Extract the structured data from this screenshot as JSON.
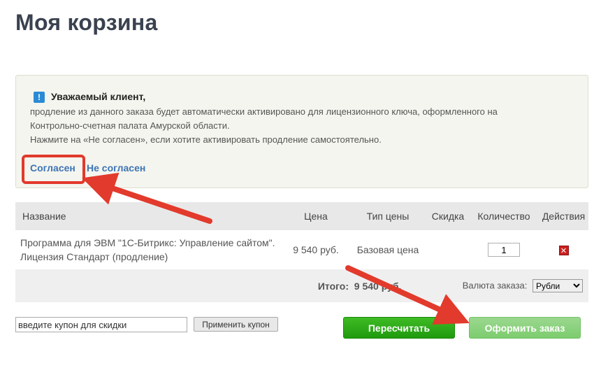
{
  "page": {
    "title": "Моя корзина"
  },
  "notice": {
    "heading": "Уважаемый клиент,",
    "line1": "продление из данного заказа будет автоматически активировано для лицензионного ключа, оформленного на",
    "line2": "Контрольно-счетная палата Амурской области.",
    "line3": "Нажмите на «Не согласен», если хотите активировать продление самостоятельно.",
    "agree_label": "Согласен",
    "disagree_label": "Не согласен",
    "icon": "info-exclamation-icon"
  },
  "cart": {
    "headers": [
      "Название",
      "Цена",
      "Тип цены",
      "Скидка",
      "Количество",
      "Действия"
    ],
    "items": [
      {
        "name_line1": "Программа для ЭВМ \"1С-Битрикс: Управление сайтом\".",
        "name_line2": "Лицензия Стандарт (продление)",
        "price": "9 540 руб.",
        "price_type": "Базовая цена",
        "discount": "",
        "quantity": "1",
        "action_icon": "delete-icon"
      }
    ],
    "total_label": "Итого:",
    "total_value": "9 540 руб.",
    "currency_label": "Валюта заказа:",
    "currency_value": "Рубли"
  },
  "coupon": {
    "value": "введите купон для скидки",
    "apply_label": "Применить купон"
  },
  "actions": {
    "recalculate_label": "Пересчитать",
    "checkout_label": "Оформить заказ"
  },
  "colors": {
    "accent_green": "#1f9a0e",
    "annotation_red": "#e23a2c",
    "link_blue": "#3d74b5"
  }
}
